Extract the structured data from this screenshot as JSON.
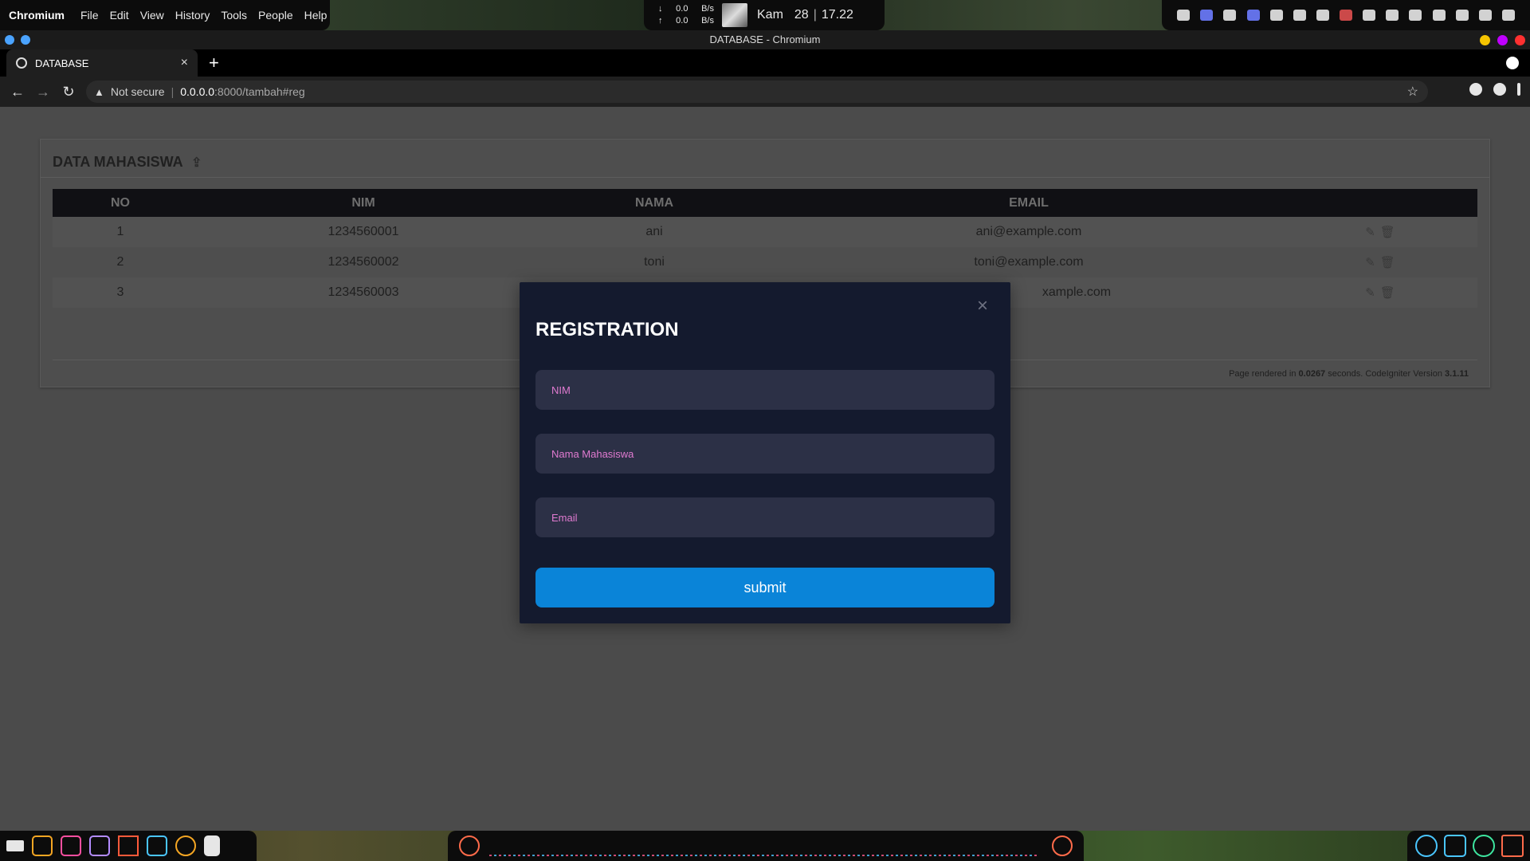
{
  "desktop": {
    "menubar": {
      "app_name": "Chromium",
      "items": [
        "File",
        "Edit",
        "View",
        "History",
        "Tools",
        "People",
        "Help"
      ]
    },
    "center_widget": {
      "down_value": "0.0",
      "down_unit": "B/s",
      "up_value": "0.0",
      "up_unit": "B/s",
      "day": "Kam",
      "date": "28",
      "time": "17.22"
    }
  },
  "window": {
    "title": "DATABASE - Chromium"
  },
  "browser": {
    "tab_title": "DATABASE",
    "new_tab_label": "+",
    "security_text": "Not secure",
    "url_host": "0.0.0.0",
    "url_path": ":8000/tambah#reg"
  },
  "page": {
    "panel_title": "DATA MAHASISWA",
    "table": {
      "headers": [
        "NO",
        "NIM",
        "NAMA",
        "EMAIL"
      ],
      "rows": [
        {
          "no": "1",
          "nim": "1234560001",
          "nama": "ani",
          "email": "ani@example.com"
        },
        {
          "no": "2",
          "nim": "1234560002",
          "nama": "toni",
          "email": "toni@example.com"
        },
        {
          "no": "3",
          "nim": "1234560003",
          "nama": "",
          "email": "xample.com"
        }
      ]
    },
    "footer": {
      "prefix": "Page rendered in",
      "time": "0.0267",
      "middle": "seconds. CodeIgniter Version",
      "version": "3.1.11"
    }
  },
  "modal": {
    "title": "REGISTRATION",
    "close_label": "×",
    "fields": {
      "nim_placeholder": "NIM",
      "nama_placeholder": "Nama Mahasiswa",
      "email_placeholder": "Email"
    },
    "submit_label": "submit"
  },
  "colors": {
    "modal_bg": "#141a2e",
    "field_bg": "#2c3046",
    "placeholder": "#e07ad0",
    "submit": "#0a84d8"
  }
}
